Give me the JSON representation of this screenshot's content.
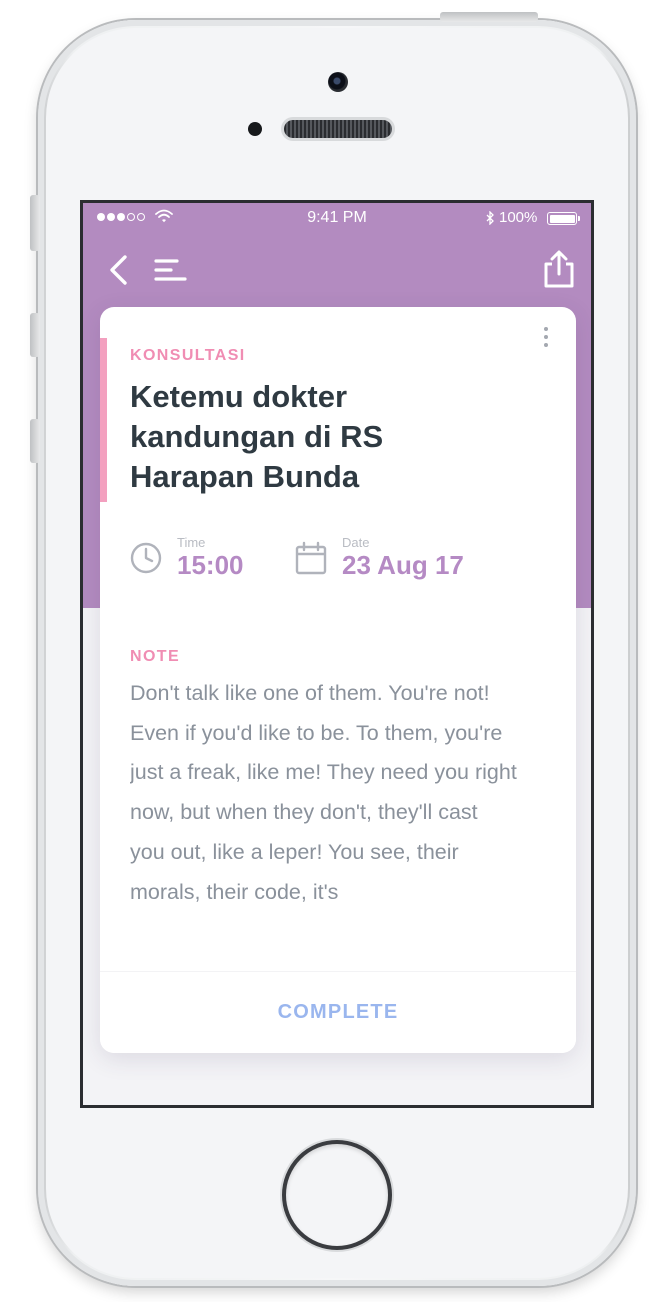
{
  "status_bar": {
    "time": "9:41 PM",
    "battery": "100%",
    "icons": [
      "signal-dots",
      "wifi-icon",
      "bluetooth-icon",
      "battery-icon"
    ]
  },
  "nav": {
    "icons": [
      "back-chevron-icon",
      "menu-icon",
      "share-icon"
    ]
  },
  "card": {
    "category": "KONSULTASI",
    "title": "Ketemu dokter kandungan di RS Harapan Bunda",
    "time_caption": "Time",
    "time_value": "15:00",
    "date_caption": "Date",
    "date_value": "23 Aug 17",
    "note_label": "NOTE",
    "note_text": "Don't talk like one of them. You're not! Even if you'd like to be. To them, you're just a freak, like me! They need you right now, but when they don't, they'll cast you out, like a leper! You see, their morals, their code, it's",
    "complete_label": "COMPLETE"
  },
  "colors": {
    "header": "#b38bc0",
    "accent_pink": "#f08db3",
    "title_text": "#2f3a42",
    "meta_value": "#b58ac4",
    "note_text": "#8a919b",
    "complete": "#9ab6ee"
  }
}
